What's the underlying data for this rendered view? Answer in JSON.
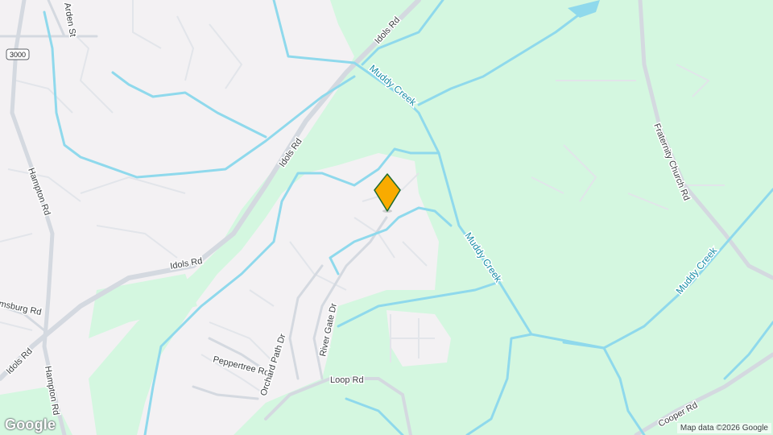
{
  "map": {
    "colors": {
      "land": "#f3f1f3",
      "park": "#d4f7e0",
      "water": "#8fd9ec",
      "road": "#d4d9e0",
      "minor_road": "#e2e5ea",
      "marker_fill": "#f9ab00",
      "marker_stroke": "#1e6b2f"
    },
    "roads": {
      "idols_rd_top": "Idols Rd",
      "idols_rd_mid": "Idols Rd",
      "idols_rd_low": "Idols Rd",
      "idols_rd_left": "Idols Rd",
      "arden_st": "Arden St",
      "hampton_rd_upper": "Hampton Rd",
      "hampton_rd_lower": "Hampton Rd",
      "williamsburg_rd": "msburg Rd",
      "fraternity_church_rd": "Fraternity Church Rd",
      "peppertree_rd": "Peppertree Rd",
      "orchard_path_dr": "Orchard Path Dr",
      "river_gate_dr": "River Gate Dr",
      "loop_rd": "Loop Rd",
      "cooper_rd": "Cooper Rd"
    },
    "waterways": {
      "muddy_creek_1": "Muddy Creek",
      "muddy_creek_2": "Muddy Creek",
      "muddy_creek_3": "Muddy Creek"
    },
    "route_shield": "3000",
    "marker_icon": "location-pin-icon",
    "logo": "Google",
    "attribution": "Map data ©2026 Google"
  }
}
